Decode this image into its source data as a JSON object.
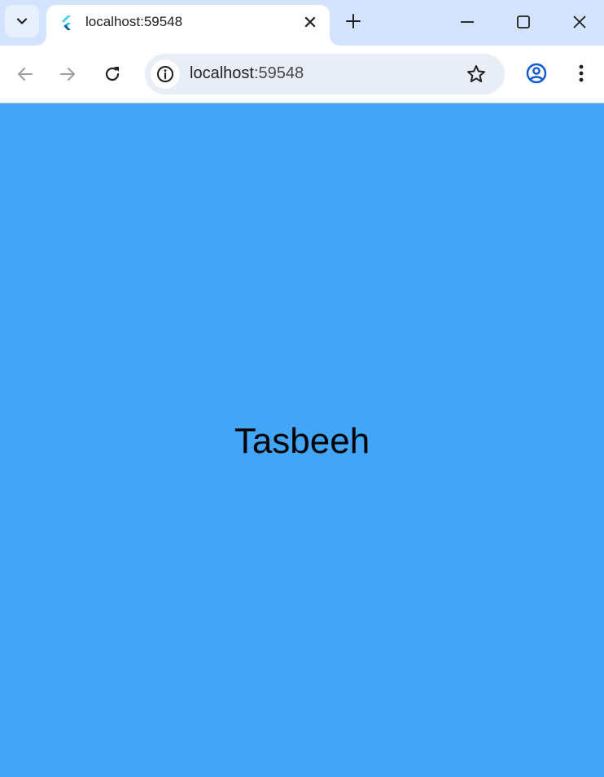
{
  "browser": {
    "tab": {
      "title": "localhost:59548",
      "favicon": "flutter-logo-icon"
    },
    "address_bar": {
      "host": "localhost",
      "port": ":59548"
    },
    "icons": {
      "tab_search": "chevron-down-icon",
      "tab_close": "close-icon",
      "new_tab": "plus-icon",
      "minimize": "minimize-icon",
      "maximize": "maximize-icon",
      "close_window": "close-icon",
      "back": "arrow-left-icon",
      "forward": "arrow-right-icon",
      "reload": "reload-icon",
      "site_info": "info-icon",
      "bookmark": "star-icon",
      "profile": "profile-icon",
      "menu": "more-vert-icon"
    },
    "colors": {
      "tabstrip": "#d3e3fd",
      "omnibox": "#e9eef6"
    }
  },
  "app": {
    "title": "Tasbeeh",
    "background": "#42a5f5"
  }
}
